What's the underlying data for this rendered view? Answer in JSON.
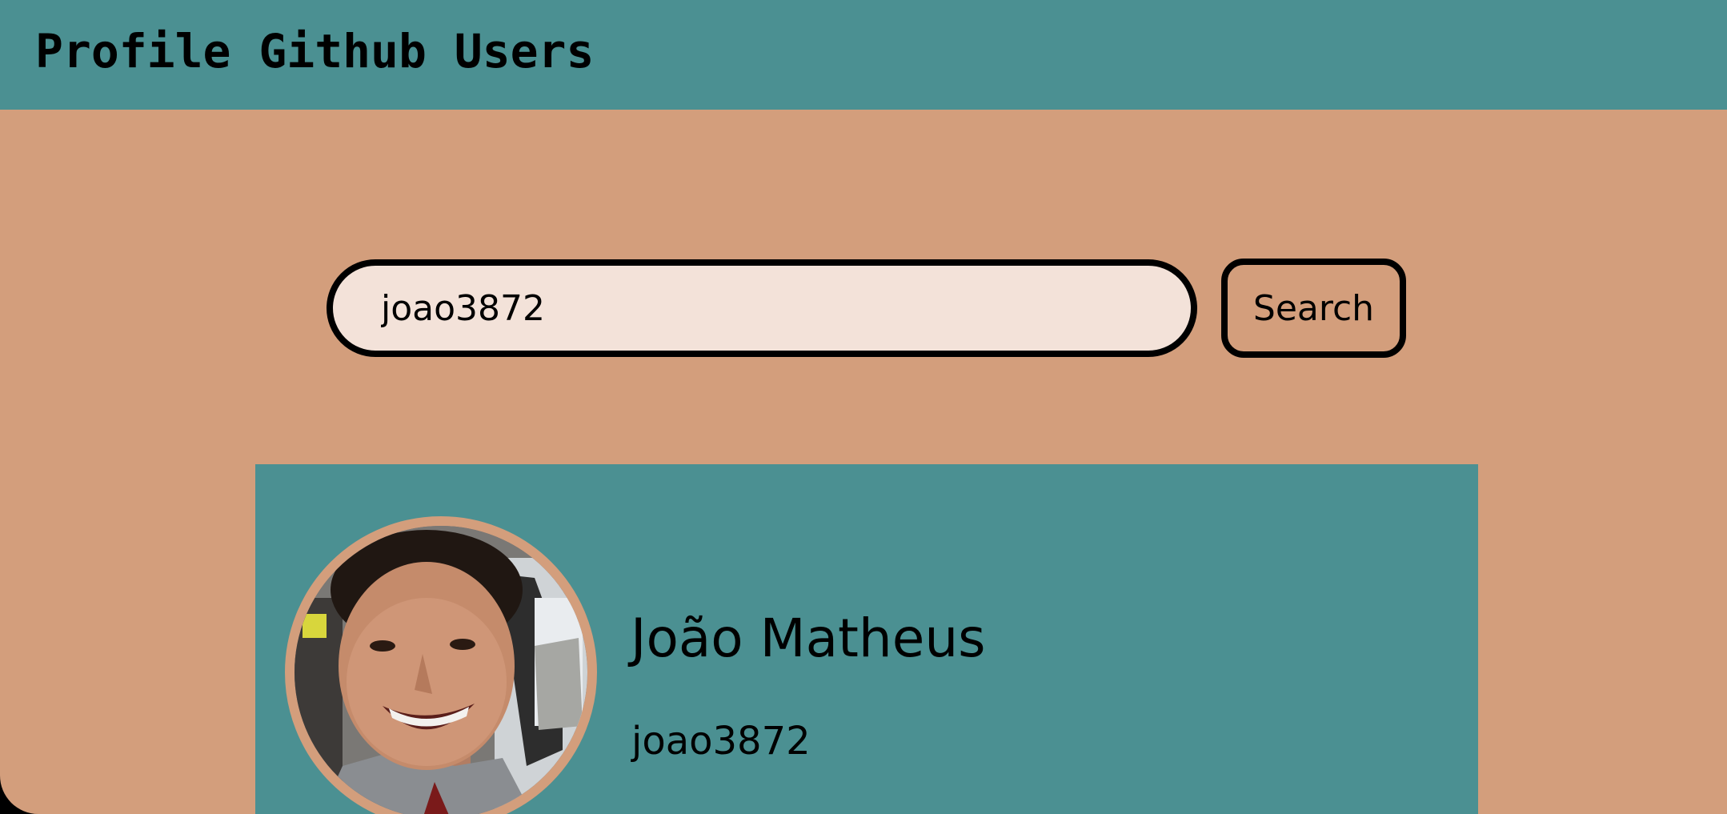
{
  "header": {
    "title": "Profile Github Users"
  },
  "search": {
    "value": "joao3872",
    "button_label": "Search"
  },
  "profile": {
    "name": "João Matheus",
    "login": "joao3872",
    "avatar_icon": "user-avatar-photo"
  },
  "colors": {
    "teal": "#4b9092",
    "tan": "#d39e7c",
    "input_bg": "#f3e2d9",
    "border": "#000000"
  }
}
